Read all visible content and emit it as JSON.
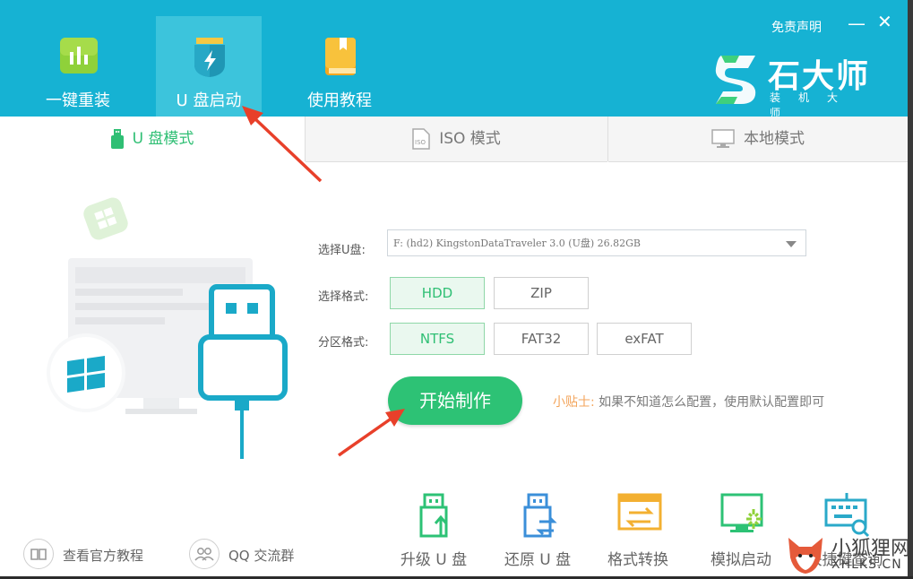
{
  "header": {
    "nav": [
      {
        "label": "一键重装",
        "icon": "bar-chart-icon"
      },
      {
        "label": "U 盘启动",
        "icon": "usb-flash-icon"
      },
      {
        "label": "使用教程",
        "icon": "book-icon"
      }
    ],
    "disclaimer": "免责声明",
    "minimize": "—",
    "close": "✕",
    "brand_name": "石大师",
    "brand_sub": "装机大师"
  },
  "tabs": [
    {
      "label": "U 盘模式",
      "icon": "usb-drive-icon"
    },
    {
      "label": "ISO 模式",
      "icon": "iso-file-icon"
    },
    {
      "label": "本地模式",
      "icon": "monitor-icon"
    }
  ],
  "form": {
    "drive_label": "选择U盘:",
    "drive_value": "F: (hd2) KingstonDataTraveler 3.0 (U盘) 26.82GB",
    "format_label": "选择格式:",
    "format_options": [
      "HDD",
      "ZIP"
    ],
    "partition_label": "分区格式:",
    "partition_options": [
      "NTFS",
      "FAT32",
      "exFAT"
    ],
    "start_button": "开始制作",
    "tip_label": "小贴士:",
    "tip_text": "如果不知道怎么配置，使用默认配置即可"
  },
  "bottom_links": [
    {
      "label": "查看官方教程",
      "icon": "book-open-icon"
    },
    {
      "label": "QQ 交流群",
      "icon": "users-icon"
    }
  ],
  "tools": [
    {
      "label": "升级 U 盘",
      "icon": "usb-upgrade-icon"
    },
    {
      "label": "还原 U 盘",
      "icon": "usb-restore-icon"
    },
    {
      "label": "格式转换",
      "icon": "format-convert-icon"
    },
    {
      "label": "模拟启动",
      "icon": "simulate-boot-icon"
    },
    {
      "label": "快捷键查询",
      "icon": "keyboard-search-icon"
    }
  ],
  "watermark": {
    "text_cn": "小狐狸网",
    "text_en": "XHLKS.CN"
  },
  "colors": {
    "header_bg": "#16b2d3",
    "accent_green": "#2dc275",
    "tip_orange": "#f3a55c",
    "arrow_red": "#e8402a"
  }
}
